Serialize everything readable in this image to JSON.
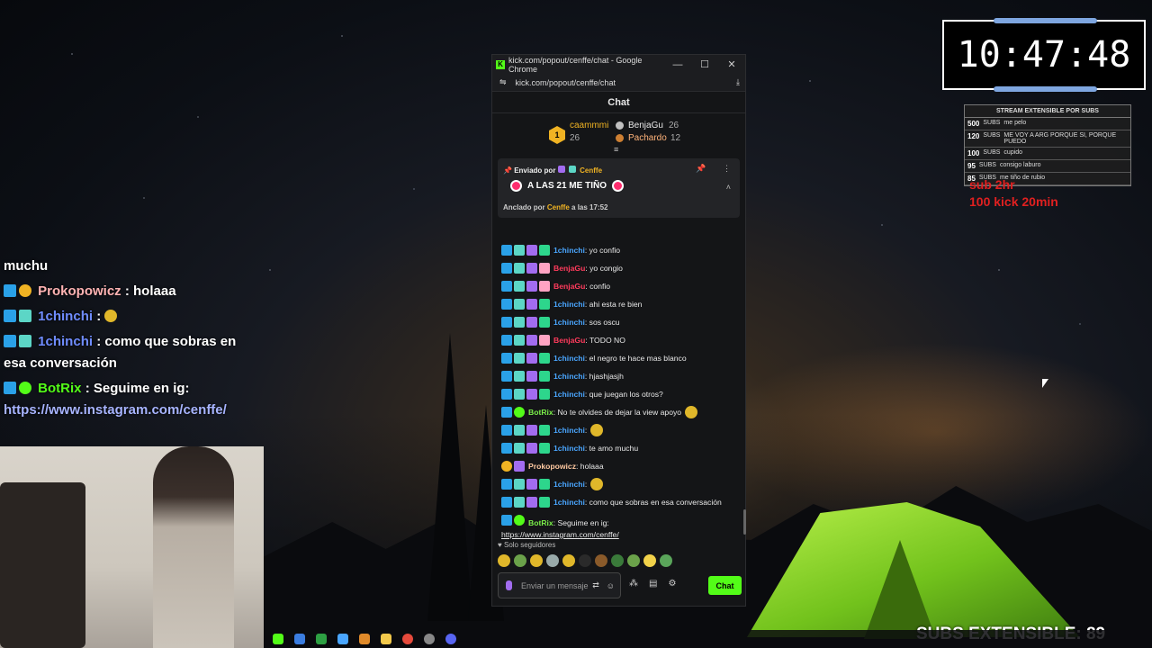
{
  "timer": {
    "time": "10:47:48"
  },
  "subs_table": {
    "title": "STREAM EXTENSIBLE POR SUBS",
    "rows": [
      {
        "count": "500",
        "unit": "SUBS",
        "text": "me pelo"
      },
      {
        "count": "120",
        "unit": "SUBS",
        "text": "ME VOY A ARG PORQUE SI, PORQUE PUEDO"
      },
      {
        "count": "100",
        "unit": "SUBS",
        "text": "cupido"
      },
      {
        "count": "95",
        "unit": "SUBS",
        "text": "consigo laburo"
      },
      {
        "count": "85",
        "unit": "SUBS",
        "text": "me tiño de rubio"
      }
    ]
  },
  "red_note": {
    "line1": "sub 2hr",
    "line2": "100 kick 20min"
  },
  "subs_extensible": "SUBS EXTENSIBLE: 89",
  "overlay_chat": [
    {
      "user": "",
      "text": "muchu"
    },
    {
      "user": "Prokopowicz",
      "text": ": holaaa"
    },
    {
      "user": "1chinchi",
      "text": ":"
    },
    {
      "user": "1chinchi",
      "text": ": como que sobras en esa conversación"
    },
    {
      "user": "BotRix",
      "text": ": Seguime en ig:"
    }
  ],
  "overlay_link": "https://www.instagram.com/cenffe/",
  "window": {
    "title": "kick.com/popout/cenffe/chat - Google Chrome",
    "url": "kick.com/popout/cenffe/chat",
    "minimize": "—",
    "maximize": "☐",
    "close": "✕"
  },
  "chat": {
    "header": "Chat",
    "gifters": [
      {
        "name": "caammmi",
        "count": "26",
        "rank": "1"
      },
      {
        "name": "BenjaGu",
        "count": "26"
      },
      {
        "name": "Pachardo",
        "count": "12"
      }
    ],
    "pinned": {
      "sent_by": "Enviado por",
      "sender": "Cenffe",
      "message": "A LAS 21 ME TIÑO",
      "pinned_by": "Anclado por",
      "pinner": "Cenffe",
      "time": "a las 17:52"
    },
    "messages": [
      {
        "user": "1chinchi",
        "text": ": yo confio",
        "color": "blue"
      },
      {
        "user": "BenjaGu",
        "text": ": yo congio",
        "color": "red"
      },
      {
        "user": "BenjaGu",
        "text": ": confio",
        "color": "red"
      },
      {
        "user": "1chinchi",
        "text": ": ahi esta re bien",
        "color": "blue"
      },
      {
        "user": "1chinchi",
        "text": ": sos oscu",
        "color": "blue"
      },
      {
        "user": "BenjaGu",
        "text": ": TODO NO",
        "color": "red"
      },
      {
        "user": "1chinchi",
        "text": ": el negro te hace mas blanco",
        "color": "blue"
      },
      {
        "user": "1chinchi",
        "text": ": hjashjasjh",
        "color": "blue"
      },
      {
        "user": "1chinchi",
        "text": ": que juegan los otros?",
        "color": "blue"
      },
      {
        "user": "BotRix",
        "text": ": No te olvides de dejar la view apoyo",
        "color": "green"
      },
      {
        "user": "1chinchi",
        "text": ":",
        "color": "blue"
      },
      {
        "user": "1chinchi",
        "text": ": te amo muchu",
        "color": "blue"
      },
      {
        "user": "Prokopowicz",
        "text": ": holaaa",
        "color": "peach"
      },
      {
        "user": "1chinchi",
        "text": ":",
        "color": "blue"
      },
      {
        "user": "1chinchi",
        "text": ": como que sobras en esa conversación",
        "color": "blue"
      }
    ],
    "last_bot": {
      "user": "BotRix",
      "text": ": Seguime en ig:",
      "link": "https://www.instagram.com/cenffe/"
    },
    "followers_only": "Solo seguidores",
    "input_placeholder": "Enviar un mensaje",
    "send_label": "Chat"
  }
}
